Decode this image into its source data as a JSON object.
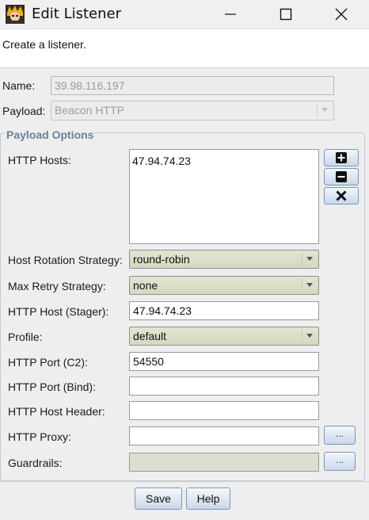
{
  "window": {
    "title": "Edit Listener",
    "icon": "app-avatar-icon",
    "controls": [
      "minimize-icon",
      "maximize-icon",
      "close-icon"
    ]
  },
  "header": {
    "description": "Create a listener."
  },
  "form": {
    "name_label": "Name:",
    "name_value": "39.98.116.197",
    "payload_label": "Payload:",
    "payload_value": "Beacon HTTP"
  },
  "payload_options": {
    "legend": "Payload Options",
    "http_hosts_label": "HTTP Hosts:",
    "http_hosts_value": "47.94.74.23",
    "host_buttons": [
      "add-icon",
      "remove-icon",
      "clear-icon"
    ],
    "host_rotation_label": "Host Rotation Strategy:",
    "host_rotation_value": "round-robin",
    "max_retry_label": "Max Retry Strategy:",
    "max_retry_value": "none",
    "http_host_stager_label": "HTTP Host (Stager):",
    "http_host_stager_value": "47.94.74.23",
    "profile_label": "Profile:",
    "profile_value": "default",
    "http_port_c2_label": "HTTP Port (C2):",
    "http_port_c2_value": "54550",
    "http_port_bind_label": "HTTP Port (Bind):",
    "http_port_bind_value": "",
    "http_host_header_label": "HTTP Host Header:",
    "http_host_header_value": "",
    "http_proxy_label": "HTTP Proxy:",
    "http_proxy_value": "",
    "http_proxy_button": "...",
    "guardrails_label": "Guardrails:",
    "guardrails_value": "",
    "guardrails_button": "..."
  },
  "footer": {
    "save_label": "Save",
    "help_label": "Help"
  },
  "colors": {
    "legend": "#6b7f9c",
    "combo": "#d8dec6",
    "button_border": "#7f95b3"
  }
}
